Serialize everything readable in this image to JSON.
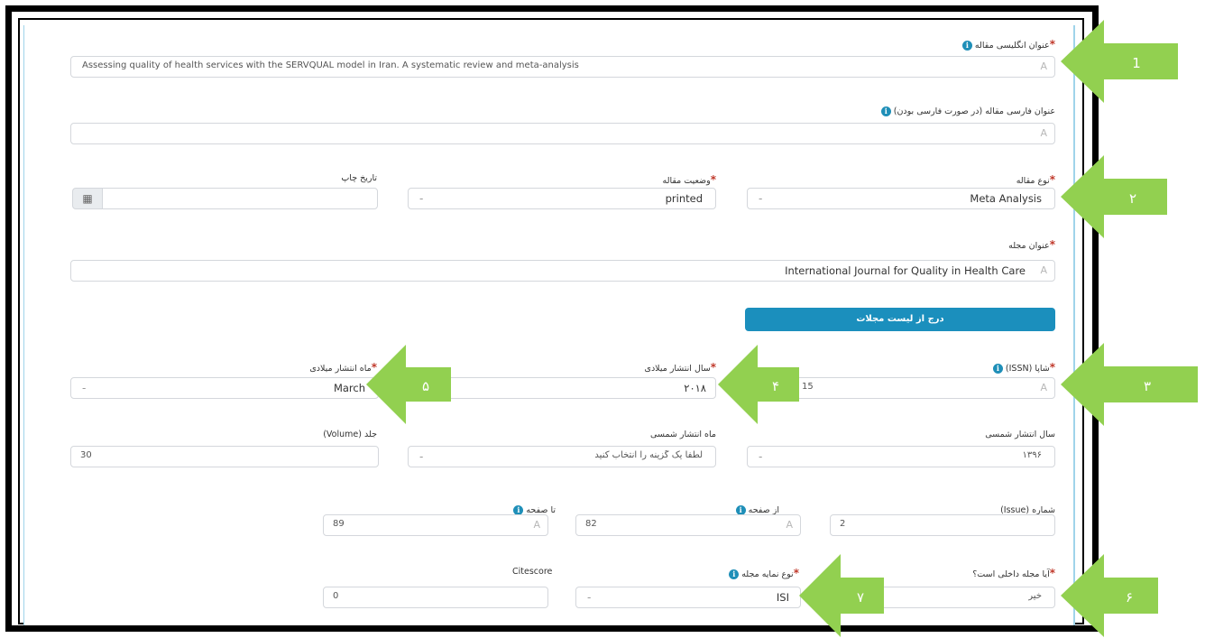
{
  "form": {
    "english_title_label": "عنوان انگلیسی مقاله",
    "english_title_value": "Assessing quality of health services with the SERVQUAL model in Iran. A systematic review and meta-analysis",
    "persian_title_label": "عنوان فارسی مقاله (در صورت فارسی بودن)",
    "persian_title_value": "",
    "article_type_label": "نوع مقاله",
    "article_type_value": "Meta Analysis",
    "article_status_label": "وضعیت مقاله",
    "article_status_value": "printed",
    "print_date_label": "تاریخ چاپ",
    "print_date_value": "",
    "journal_title_label": "عنوان مجله",
    "journal_title_value": "International Journal for Quality in Health Care",
    "journal_list_button": "درج از لیست مجلات",
    "issn_label": "شاپا (ISSN)",
    "issn_value": "15",
    "pub_year_label": "سال انتشار میلادی",
    "pub_year_value": "۲۰۱۸",
    "pub_month_label": "ماه انتشار میلادی",
    "pub_month_value": "March",
    "solar_year_label": "سال انتشار شمسی",
    "solar_year_value": "۱۳۹۶",
    "solar_month_label": "ماه انتشار شمسی",
    "solar_month_value": "لطفا یک گزینه را انتخاب کنید",
    "volume_label": "جلد (Volume)",
    "volume_value": "30",
    "issue_label": "شماره (Issue)",
    "issue_value": "2",
    "from_page_label": "از صفحه",
    "from_page_value": "82",
    "to_page_label": "تا صفحه",
    "to_page_value": "89",
    "domestic_label": "آیا مجله داخلی است؟",
    "domestic_value": "خیر",
    "index_type_label": "نوع نمایه مجله",
    "index_type_value": "ISI",
    "citescore_label": "Citescore",
    "citescore_value": "0",
    "dash": "-",
    "text_icon": "A",
    "info_glyph": "i",
    "required_mark": "*",
    "calendar_icon": "▦"
  },
  "annotations": [
    "1",
    "۲",
    "۳",
    "۴",
    "۵",
    "۶",
    "۷"
  ],
  "colors": {
    "arrow": "#92d050",
    "button": "#1b8fbd",
    "required": "#c0392b",
    "info": "#1f8fb8"
  }
}
